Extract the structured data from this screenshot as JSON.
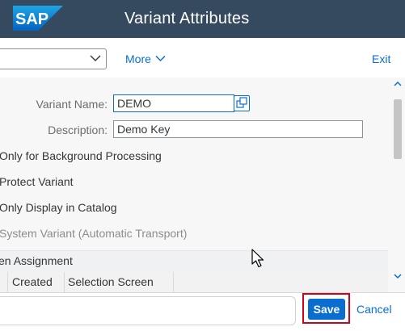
{
  "header": {
    "logo_text": "SAP",
    "title": "Variant Attributes"
  },
  "toolbar": {
    "dropdown_value": "",
    "more_label": "More",
    "exit_label": "Exit"
  },
  "form": {
    "variant_name_label": "Variant Name:",
    "variant_name_value": "DEMO",
    "description_label": "Description:",
    "description_value": "Demo Key",
    "options": [
      {
        "label": "Only for Background Processing",
        "enabled": true
      },
      {
        "label": "Protect Variant",
        "enabled": true
      },
      {
        "label": "Only Display in Catalog",
        "enabled": true
      },
      {
        "label": "System Variant (Automatic Transport)",
        "enabled": false
      }
    ]
  },
  "screen_assignment": {
    "title": "en Assignment",
    "columns": [
      "Created",
      "Selection Screen"
    ]
  },
  "footer": {
    "command_value": "",
    "save_label": "Save",
    "cancel_label": "Cancel"
  },
  "colors": {
    "shell": "#354a5f",
    "accent": "#0a6ed1",
    "highlight": "#d0021b"
  }
}
